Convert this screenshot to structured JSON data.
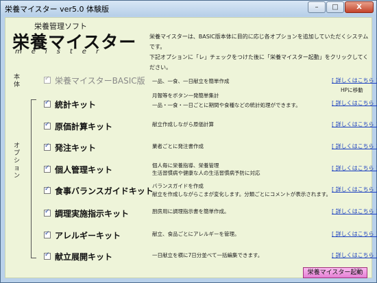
{
  "window": {
    "title": "栄養マイスター ver5.0 体験版"
  },
  "logo": {
    "subtitle": "栄養管理ソフト",
    "main": "栄養マイスター",
    "roman": "meister"
  },
  "intro": {
    "line1": "栄養マイスターは、BASIC版本体に目的に応じ各オプションを追加していただくシステムです。",
    "line2": "下記オプションに「レ」チェックをつけた後に「栄養マイスター起動」をクリックしてください。"
  },
  "sections": {
    "main": "本体",
    "options": "オプション"
  },
  "detail_label": "[ 詳しくはこちら ]",
  "hp_note": "HPに移動",
  "base": {
    "name": "栄養マイスターBASIC版",
    "desc": "一品、一食、一日献立を簡単作成",
    "checked": true
  },
  "options": [
    {
      "name": "統計キット",
      "desc_above": "月報等をボタン一発簡単集計",
      "desc": "一品・一食・一日ごとに期間や食種などの統計処理ができます。",
      "checked": true
    },
    {
      "name": "原価計算キット",
      "desc": "献立作成しながら原価計算",
      "checked": true
    },
    {
      "name": "発注キット",
      "desc": "業者ごとに発注書作成",
      "checked": true
    },
    {
      "name": "個人管理キット",
      "desc": "個人毎に栄養指導、栄養管理",
      "desc2": "生活習慣病や健康な人の生活習慣病予防に対応",
      "checked": true
    },
    {
      "name": "食事バランスガイドキット",
      "desc": "バランスガイドを作成",
      "desc2": "献立を作成しながらこまが変化します。分類ごとにコメントが表示されます。",
      "checked": true
    },
    {
      "name": "調理実施指示キット",
      "desc": "厨房用に調理指示書を簡単作成。",
      "checked": true
    },
    {
      "name": "アレルギーキット",
      "desc": "献立、食品ごとにアレルギーを管理。",
      "checked": true
    },
    {
      "name": "献立展開キット",
      "desc": "一日献立を横に7日分並べて一括編集できます。",
      "checked": true
    }
  ],
  "launch_button": "栄養マイスター起動",
  "window_buttons": {
    "minimize": "–",
    "maximize": "□",
    "close": "X"
  }
}
